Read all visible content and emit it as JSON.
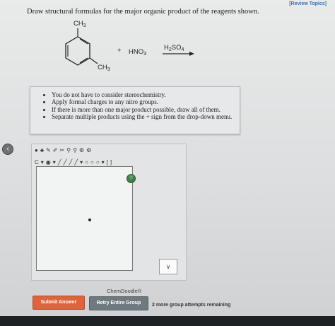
{
  "header": {
    "review_link": "[Review Topics]"
  },
  "question": {
    "prompt": "Draw structural formulas for the major organic product of the reagents shown."
  },
  "reaction": {
    "substituent_top": "CH3",
    "substituent_bottom": "CH3",
    "plus": "+",
    "reagent": "HNO3",
    "catalyst": "H2SO4"
  },
  "instructions": [
    "You do not have to consider stereochemistry.",
    "Apply formal charges to any nitro groups.",
    "If there is more than one major product possible, draw all of them.",
    "Separate multiple products using the + sign from the drop-down menu."
  ],
  "editor": {
    "brand": "ChemDoodle®",
    "dropdown_symbol": "∨",
    "toolbar_row1": [
      "●",
      "♣",
      "✎",
      "✐",
      "✂",
      "⚲",
      "⚲",
      "⚙",
      "⚙"
    ],
    "toolbar_row2": [
      "C",
      "▾",
      "◉",
      "▾",
      "╱",
      "╱",
      "╱",
      "╱",
      "▾",
      "○",
      "○",
      "○",
      "▾",
      "[",
      "]"
    ]
  },
  "buttons": {
    "submit": "Submit Answer",
    "retry": "Retry Entire Group"
  },
  "attempts": "2 more group attempts remaining"
}
